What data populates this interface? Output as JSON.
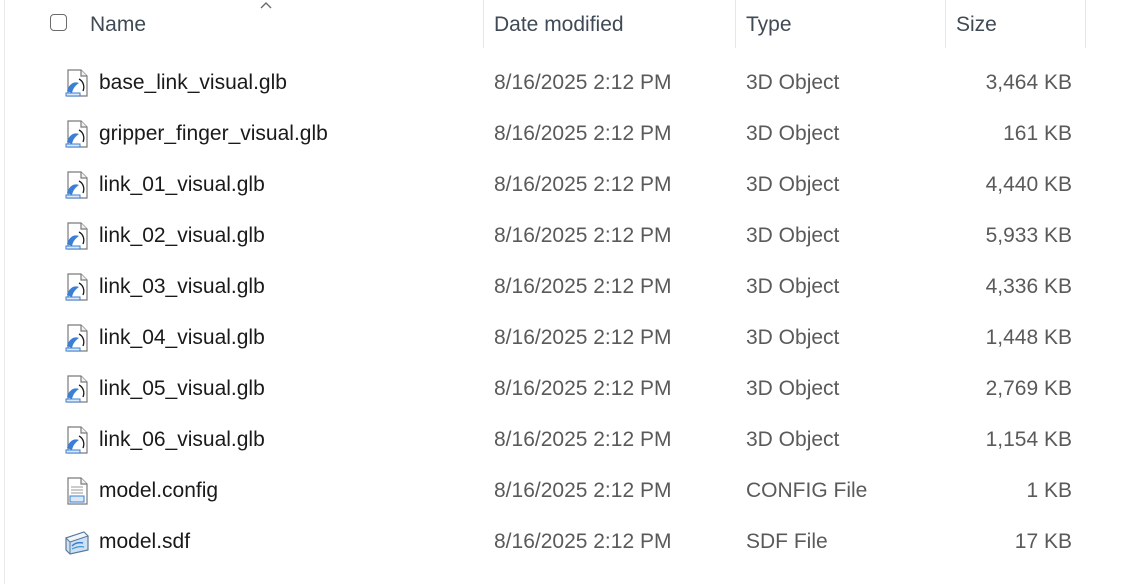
{
  "header": {
    "name_label": "Name",
    "date_label": "Date modified",
    "type_label": "Type",
    "size_label": "Size",
    "sort_indicator_icon": "chevron-up-icon"
  },
  "files": [
    {
      "name": "base_link_visual.glb",
      "date": "8/16/2025 2:12 PM",
      "type": "3D Object",
      "size": "3,464 KB",
      "icon": "3d-object-file-icon"
    },
    {
      "name": "gripper_finger_visual.glb",
      "date": "8/16/2025 2:12 PM",
      "type": "3D Object",
      "size": "161 KB",
      "icon": "3d-object-file-icon"
    },
    {
      "name": "link_01_visual.glb",
      "date": "8/16/2025 2:12 PM",
      "type": "3D Object",
      "size": "4,440 KB",
      "icon": "3d-object-file-icon"
    },
    {
      "name": "link_02_visual.glb",
      "date": "8/16/2025 2:12 PM",
      "type": "3D Object",
      "size": "5,933 KB",
      "icon": "3d-object-file-icon"
    },
    {
      "name": "link_03_visual.glb",
      "date": "8/16/2025 2:12 PM",
      "type": "3D Object",
      "size": "4,336 KB",
      "icon": "3d-object-file-icon"
    },
    {
      "name": "link_04_visual.glb",
      "date": "8/16/2025 2:12 PM",
      "type": "3D Object",
      "size": "1,448 KB",
      "icon": "3d-object-file-icon"
    },
    {
      "name": "link_05_visual.glb",
      "date": "8/16/2025 2:12 PM",
      "type": "3D Object",
      "size": "2,769 KB",
      "icon": "3d-object-file-icon"
    },
    {
      "name": "link_06_visual.glb",
      "date": "8/16/2025 2:12 PM",
      "type": "3D Object",
      "size": "1,154 KB",
      "icon": "3d-object-file-icon"
    },
    {
      "name": "model.config",
      "date": "8/16/2025 2:12 PM",
      "type": "CONFIG File",
      "size": "1 KB",
      "icon": "config-file-icon"
    },
    {
      "name": "model.sdf",
      "date": "8/16/2025 2:12 PM",
      "type": "SDF File",
      "size": "17 KB",
      "icon": "sdf-file-icon"
    }
  ],
  "colors": {
    "header_text": "#404a55",
    "name_text": "#1a1a1a",
    "detail_text": "#5a5a5a",
    "icon_blue": "#3a7fd5"
  }
}
